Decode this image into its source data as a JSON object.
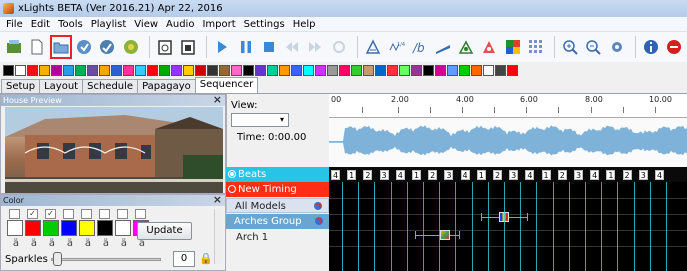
{
  "window": {
    "title": "xLights BETA (Ver 2016.21) Apr 22, 2016"
  },
  "menu": [
    "File",
    "Edit",
    "Tools",
    "Playlist",
    "View",
    "Audio",
    "Import",
    "Settings",
    "Help"
  ],
  "toolbar": {
    "buttons": [
      {
        "name": "new-sequence-icon"
      },
      {
        "name": "new-file-icon"
      },
      {
        "name": "open-folder-icon",
        "selected": true
      },
      {
        "name": "save-icon"
      },
      {
        "name": "save-as-icon"
      },
      {
        "name": "render-icon"
      },
      {
        "name": "paste-by-time-icon"
      },
      {
        "name": "paste-by-cell-icon"
      },
      {
        "name": "play-icon"
      },
      {
        "name": "pause-icon"
      },
      {
        "name": "stop-icon"
      },
      {
        "name": "rewind-icon"
      },
      {
        "name": "fast-forward-icon"
      },
      {
        "name": "replay-icon"
      },
      {
        "name": "bucket-icon"
      },
      {
        "name": "piano-icon"
      },
      {
        "name": "timing-b-icon"
      },
      {
        "name": "toggle-icon"
      },
      {
        "name": "house-preview-icon"
      },
      {
        "name": "model-preview-icon"
      },
      {
        "name": "grid-icon"
      },
      {
        "name": "zoom-in-icon"
      },
      {
        "name": "zoom-out-icon"
      },
      {
        "name": "settings-gear-icon"
      },
      {
        "name": "info-icon"
      },
      {
        "name": "stop-sign-icon"
      }
    ]
  },
  "effect_colors": [
    "#000000",
    "#ffffff",
    "#e11",
    "#f2b200",
    "#b0009c",
    "#25a0e6",
    "#00b050",
    "#6b4d9d",
    "#ffa500",
    "#2f5fd5",
    "#ff3399",
    "#33ccff",
    "#ff0000",
    "#00aa00",
    "#9933ff",
    "#ffcc00",
    "#cc0000",
    "#333333",
    "#996633",
    "#ff66cc",
    "#000000",
    "#6633cc",
    "#00cc99",
    "#ff9900",
    "#3366ff",
    "#00ffff",
    "#cc33ff",
    "#999999",
    "#ff0066",
    "#33cc33",
    "#cc9966",
    "#0066cc",
    "#ff3333",
    "#66ff66",
    "#993399",
    "#000000",
    "#cc0099",
    "#6699ff",
    "#00cc00",
    "#ff6600",
    "#ffffff",
    "#444444",
    "#ff0000"
  ],
  "tabs": [
    {
      "label": "Setup",
      "active": false
    },
    {
      "label": "Layout",
      "active": false
    },
    {
      "label": "Schedule",
      "active": false
    },
    {
      "label": "Papagayo",
      "active": false
    },
    {
      "label": "Sequencer",
      "active": true
    }
  ],
  "house_preview": {
    "title": "House Preview",
    "close": "×"
  },
  "color_panel": {
    "title": "Color",
    "close": "×",
    "checks": [
      false,
      true,
      true,
      false,
      false,
      false,
      false,
      false
    ],
    "swatches": [
      "#ffffff",
      "#ff0000",
      "#00cc00",
      "#0000ff",
      "#ffff00",
      "#000000",
      "#ffffff",
      "#ff00ff"
    ],
    "update_label": "Update",
    "sparkles_label": "Sparkles",
    "sparkles_value": "0",
    "sparkles_level": 0.02
  },
  "view": {
    "label": "View:",
    "selected": "▾",
    "time": "Time: 0:00.00"
  },
  "timeline": {
    "ticks": [
      "00",
      "2.00",
      "4.00",
      "6.00",
      "8.00",
      "10.00"
    ]
  },
  "rows": {
    "beats": "Beats",
    "new_timing": "New Timing",
    "all_models": "All Models",
    "arches_group": "Arches Group",
    "arch1": "Arch 1"
  },
  "beat_labels": [
    "4",
    "1",
    "2",
    "3",
    "4",
    "1",
    "2",
    "3",
    "4",
    "1",
    "2",
    "3",
    "4",
    "1",
    "2",
    "3",
    "4",
    "1",
    "2",
    "3",
    "4"
  ],
  "colors": {
    "beats_row": "#28c3e6",
    "new_timing_row": "#ff2d16",
    "arches_row": "#69a6cf",
    "timing_line": "#32d2d7",
    "selected_button_outline": "#e3262a"
  }
}
